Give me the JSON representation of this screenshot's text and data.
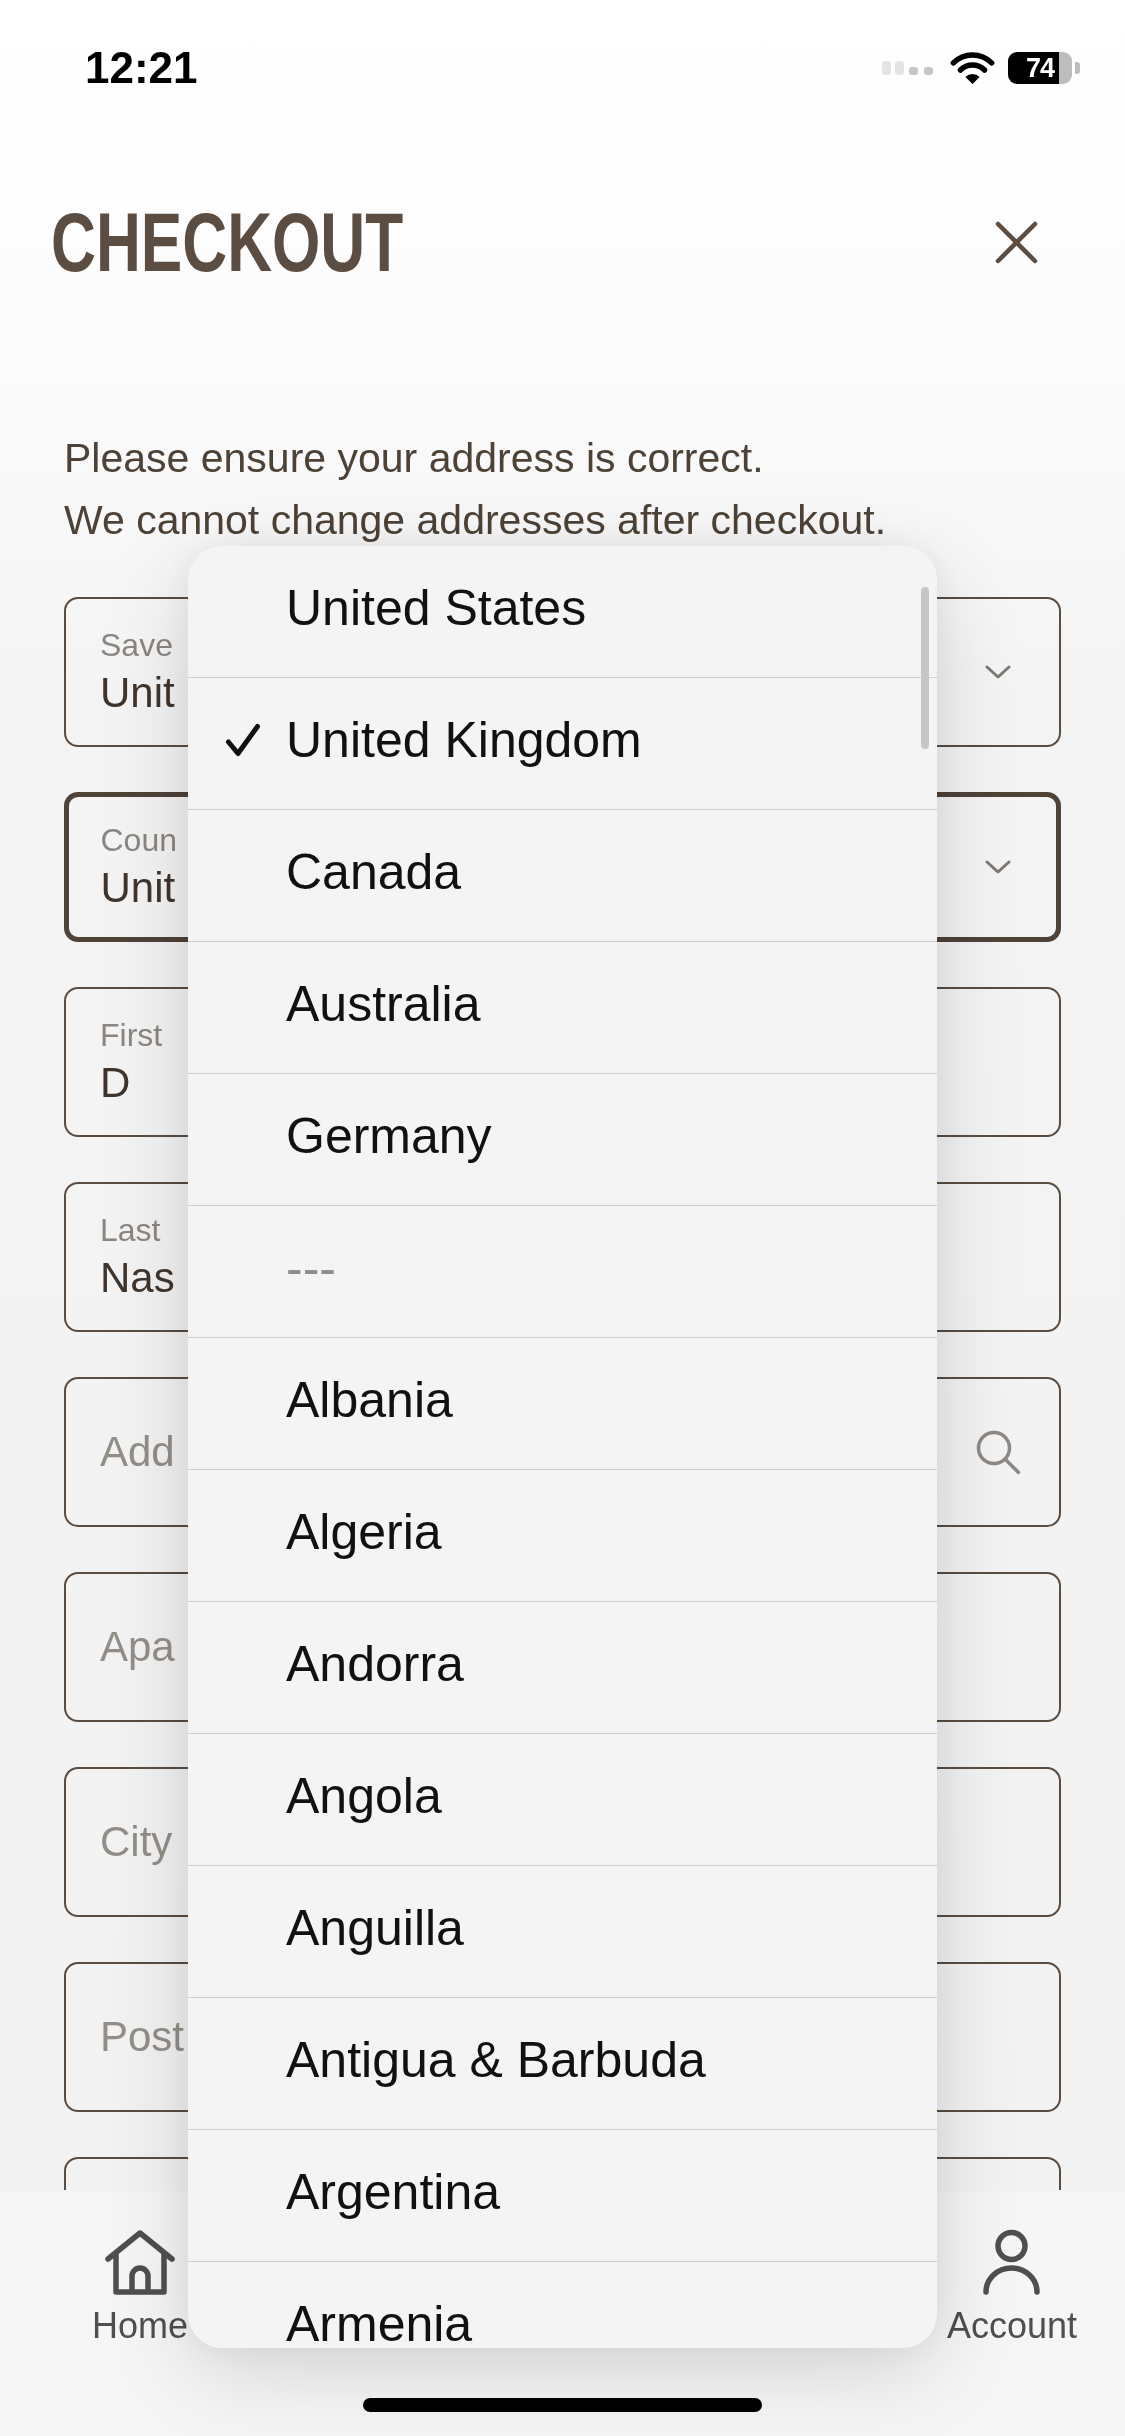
{
  "status_bar": {
    "time": "12:21",
    "battery": "74"
  },
  "header": {
    "title": "CHECKOUT"
  },
  "notice": [
    "Please ensure your address is correct.",
    "We cannot change addresses after checkout."
  ],
  "fields": [
    {
      "kind": "select",
      "label": "Save",
      "value": "Unit",
      "focused": false
    },
    {
      "kind": "select",
      "label": "Coun",
      "value": "Unit",
      "focused": true
    },
    {
      "kind": "text",
      "label": "First",
      "value": "D",
      "focused": false
    },
    {
      "kind": "text",
      "label": "Last",
      "value": "Nas",
      "focused": false
    },
    {
      "kind": "search",
      "placeholder": "Add",
      "focused": false
    },
    {
      "kind": "text",
      "placeholder": "Apa",
      "focused": false
    },
    {
      "kind": "text",
      "placeholder": "City",
      "focused": false
    },
    {
      "kind": "text",
      "placeholder": "Post",
      "focused": false
    },
    {
      "kind": "text",
      "focused": false
    }
  ],
  "country_menu": {
    "items": [
      {
        "label": "United States",
        "selected": false,
        "disabled": false
      },
      {
        "label": "United Kingdom",
        "selected": true,
        "disabled": false
      },
      {
        "label": "Canada",
        "selected": false,
        "disabled": false
      },
      {
        "label": "Australia",
        "selected": false,
        "disabled": false
      },
      {
        "label": "Germany",
        "selected": false,
        "disabled": false
      },
      {
        "label": "---",
        "selected": false,
        "disabled": true
      },
      {
        "label": "Albania",
        "selected": false,
        "disabled": false
      },
      {
        "label": "Algeria",
        "selected": false,
        "disabled": false
      },
      {
        "label": "Andorra",
        "selected": false,
        "disabled": false
      },
      {
        "label": "Angola",
        "selected": false,
        "disabled": false
      },
      {
        "label": "Anguilla",
        "selected": false,
        "disabled": false
      },
      {
        "label": "Antigua & Barbuda",
        "selected": false,
        "disabled": false
      },
      {
        "label": "Argentina",
        "selected": false,
        "disabled": false
      },
      {
        "label": "Armenia",
        "selected": false,
        "disabled": false
      }
    ]
  },
  "tab_bar": {
    "tabs": [
      {
        "kind": "home",
        "label": "Home",
        "selected": false
      },
      {
        "kind": "account",
        "label": "Account",
        "selected": false
      }
    ]
  }
}
